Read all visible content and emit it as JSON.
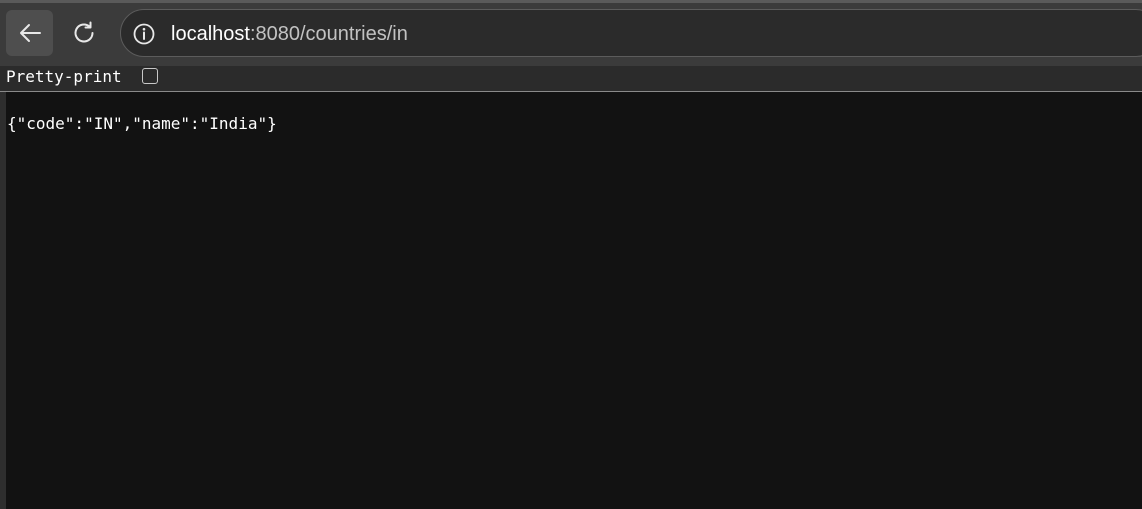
{
  "browser": {
    "back_icon": "arrow-left-icon",
    "reload_icon": "reload-icon",
    "site_info_icon": "info-icon",
    "url_host": "localhost",
    "url_rest": ":8080/countries/in"
  },
  "viewer": {
    "pretty_print_label": "Pretty-print",
    "pretty_print_checked": false,
    "body": "{\"code\":\"IN\",\"name\":\"India\"}"
  },
  "colors": {
    "toolbar": "#3b3b3b",
    "address_bar": "#2b2b2b",
    "page_background": "#121212",
    "text": "#ffffff"
  }
}
